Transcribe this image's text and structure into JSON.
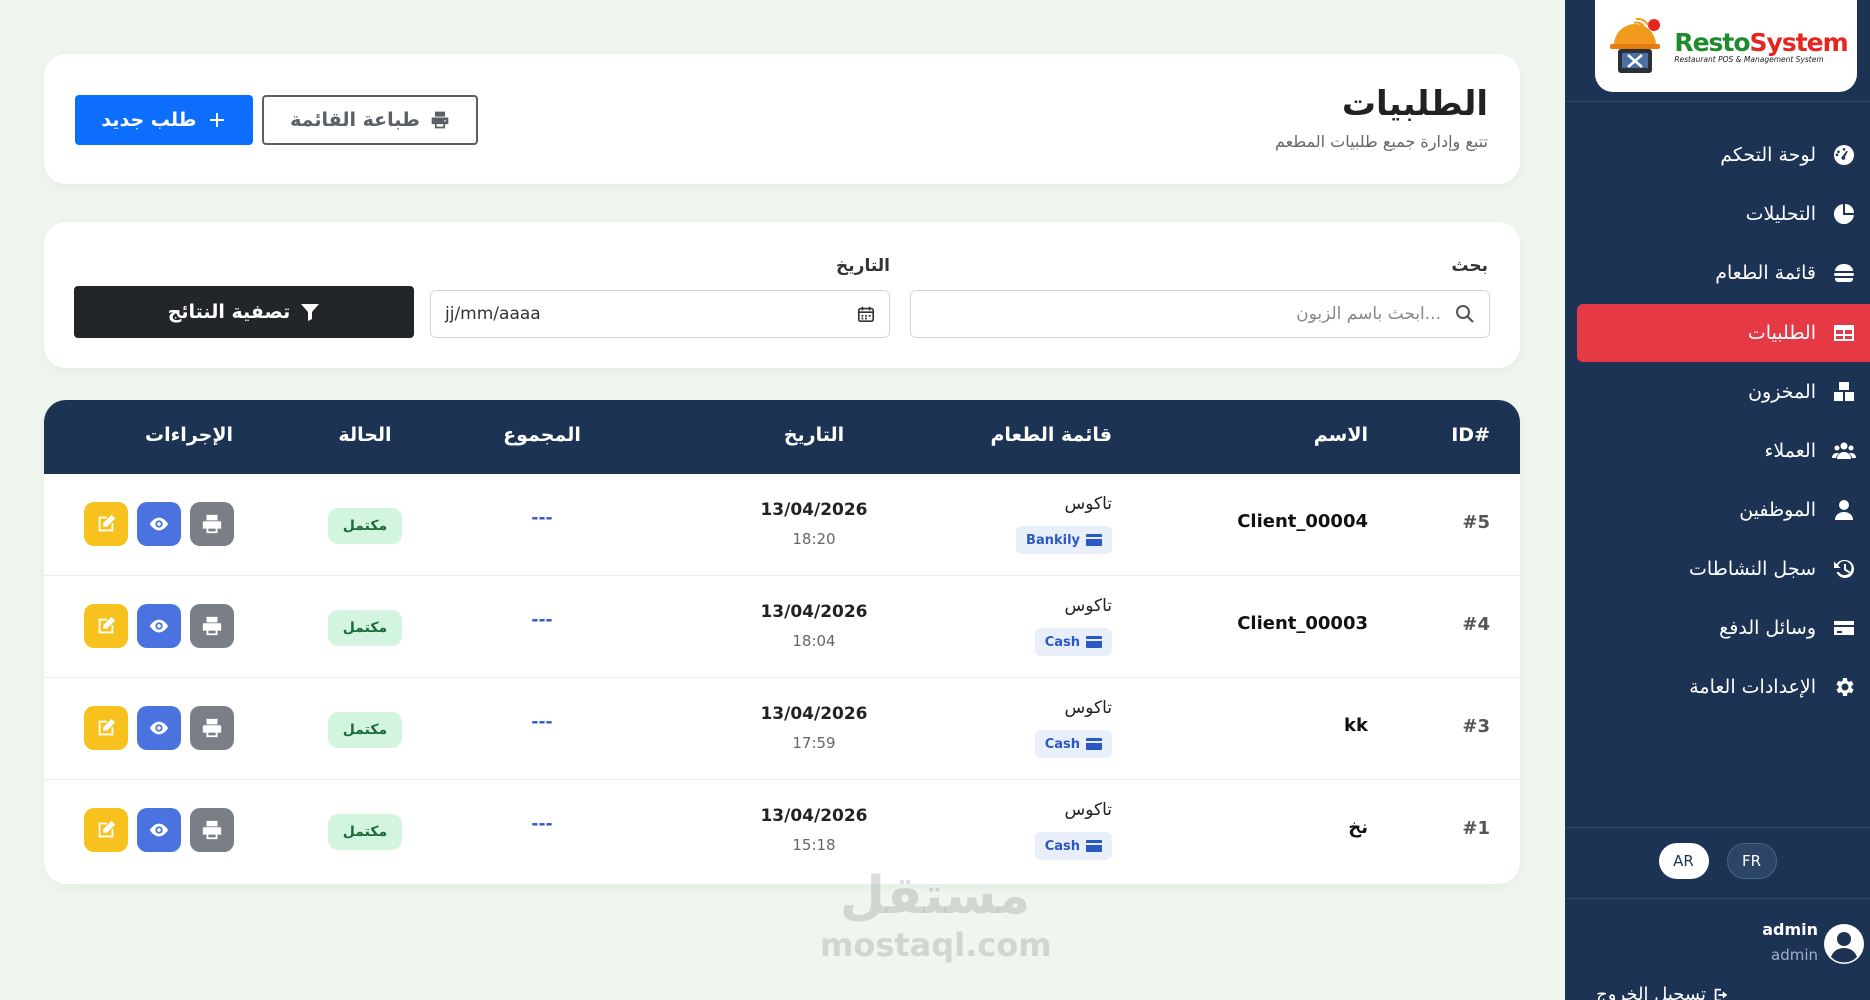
{
  "brand": {
    "name_a": "Resto",
    "name_b": "System",
    "tagline": "Restaurant POS & Management System"
  },
  "sidebar": {
    "items": [
      {
        "label": "لوحة التحكم",
        "icon": "gauge-icon",
        "active": false
      },
      {
        "label": "التحليلات",
        "icon": "pie-chart-icon",
        "active": false
      },
      {
        "label": "قائمة الطعام",
        "icon": "burger-icon",
        "active": false
      },
      {
        "label": "الطلبيات",
        "icon": "table-icon",
        "active": true
      },
      {
        "label": "المخزون",
        "icon": "boxes-icon",
        "active": false
      },
      {
        "label": "العملاء",
        "icon": "users-icon",
        "active": false
      },
      {
        "label": "الموظفين",
        "icon": "user-tie-icon",
        "active": false
      },
      {
        "label": "سجل النشاطات",
        "icon": "history-icon",
        "active": false
      },
      {
        "label": "وسائل الدفع",
        "icon": "credit-card-icon",
        "active": false
      },
      {
        "label": "الإعدادات العامة",
        "icon": "gear-icon",
        "active": false
      }
    ],
    "lang": {
      "fr": "FR",
      "ar": "AR"
    },
    "user": {
      "name": "admin",
      "role": "admin"
    },
    "logout": "تسجيل الخروج"
  },
  "header": {
    "title": "الطلبيات",
    "subtitle": "تتبع وإدارة جميع طلبيات المطعم",
    "new_label": "طلب جديد",
    "print_label": "طباعة القائمة"
  },
  "filters": {
    "search_label": "بحث",
    "search_placeholder": "ابحث باسم الزبون...",
    "date_label": "التاريخ",
    "date_placeholder": "jj/mm/aaaa",
    "filter_button": "تصفية النتائج"
  },
  "table": {
    "headers": {
      "id": "ID#",
      "name": "الاسم",
      "menu": "قائمة الطعام",
      "date": "التاريخ",
      "total": "المجموع",
      "status": "الحالة",
      "actions": "الإجراءات"
    },
    "rows": [
      {
        "id": "#5",
        "name": "Client_00004",
        "menu": "تاكوس",
        "payment": "Bankily",
        "date": "13/04/2026",
        "time": "18:20",
        "total": "---",
        "status": "مكتمل"
      },
      {
        "id": "#4",
        "name": "Client_00003",
        "menu": "تاكوس",
        "payment": "Cash",
        "date": "13/04/2026",
        "time": "18:04",
        "total": "---",
        "status": "مكتمل"
      },
      {
        "id": "#3",
        "name": "kk",
        "menu": "تاكوس",
        "payment": "Cash",
        "date": "13/04/2026",
        "time": "17:59",
        "total": "---",
        "status": "مكتمل"
      },
      {
        "id": "#1",
        "name": "نخ",
        "menu": "تاكوس",
        "payment": "Cash",
        "date": "13/04/2026",
        "time": "15:18",
        "total": "---",
        "status": "مكتمل"
      }
    ]
  },
  "watermark": {
    "ar": "مستقل",
    "en": "mostaql.com"
  },
  "colors": {
    "sidebar": "#1d3354",
    "active": "#e63946",
    "primary": "#0d6efd",
    "edit": "#f7c21d",
    "view": "#4a73e0",
    "print": "#7a7f87"
  }
}
